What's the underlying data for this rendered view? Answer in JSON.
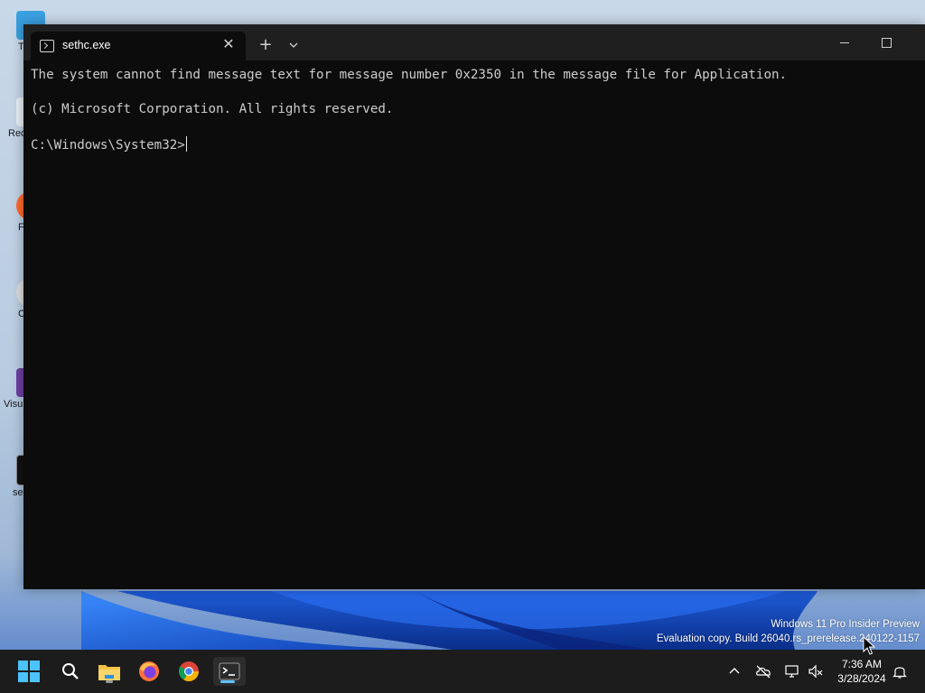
{
  "terminal": {
    "tab_title": "sethc.exe",
    "close_symbol": "✕",
    "new_tab_symbol": "+",
    "lines": [
      "The system cannot find message text for message number 0x2350 in the message file for Application.",
      "(c) Microsoft Corporation. All rights reserved.",
      "C:\\Windows\\System32>"
    ]
  },
  "watermark": {
    "line1": "Windows 11 Pro Insider Preview",
    "line2": "Evaluation copy. Build 26040.rs_prerelease.240122-1157"
  },
  "desktop": {
    "icons": [
      {
        "label": "T",
        "icon": "this-pc-icon"
      },
      {
        "label": "Rec",
        "icon": "recycle-bin-icon"
      },
      {
        "label": "F",
        "icon": "firefox-shortcut-icon"
      },
      {
        "label": "C",
        "icon": "chrome-shortcut-icon"
      },
      {
        "label": "Visu",
        "icon": "visual-studio-shortcut-icon"
      },
      {
        "label": "se",
        "icon": "sethc-shortcut-icon"
      }
    ]
  },
  "taskbar": {
    "apps": [
      {
        "name": "start",
        "icon": "windows-logo-icon"
      },
      {
        "name": "search",
        "icon": "search-icon"
      },
      {
        "name": "file-explorer",
        "icon": "folder-icon"
      },
      {
        "name": "firefox",
        "icon": "firefox-icon"
      },
      {
        "name": "chrome",
        "icon": "chrome-icon"
      },
      {
        "name": "terminal",
        "icon": "terminal-icon",
        "active": true
      }
    ],
    "tray": {
      "time": "7:36 AM",
      "date": "3/28/2024",
      "icons": [
        "chevron-up-icon",
        "onedrive-offline-icon",
        "network-icon",
        "volume-muted-icon",
        "notification-bell-icon"
      ]
    }
  },
  "colors": {
    "accent": "#5cc2ff",
    "console_bg": "#0c0c0c",
    "titlebar_bg": "#1f1f1f",
    "taskbar_bg": "#1c1c1c"
  }
}
